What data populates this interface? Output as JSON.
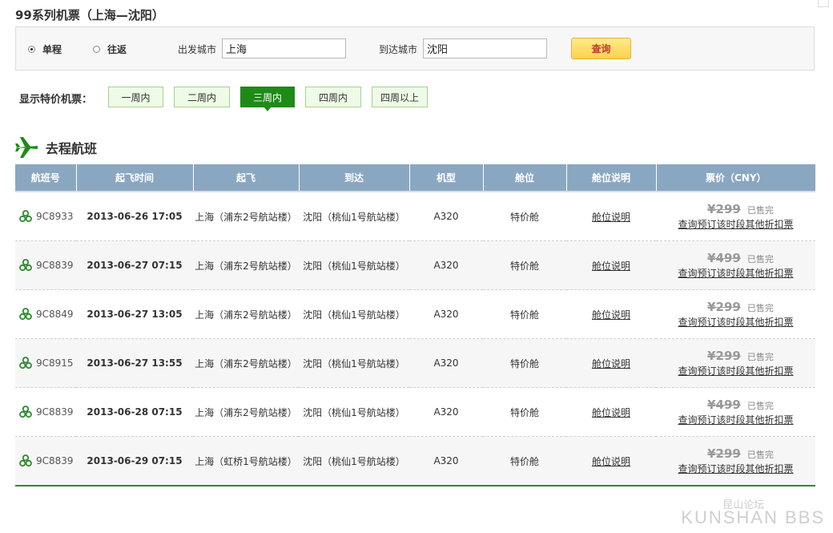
{
  "page_title": "99系列机票（上海—沈阳）",
  "search": {
    "trip_one_way": "单程",
    "trip_round": "往返",
    "from_label": "出发城市",
    "from_value": "上海",
    "to_label": "到达城市",
    "to_value": "沈阳",
    "query_button": "查询"
  },
  "filter": {
    "label": "显示特价机票：",
    "options": [
      "一周内",
      "二周内",
      "三周内",
      "四周内",
      "四周以上"
    ],
    "active": "三周内"
  },
  "section_title": "去程航班",
  "table": {
    "headers": [
      "航班号",
      "起飞时间",
      "起飞",
      "到达",
      "机型",
      "舱位",
      "舱位说明",
      "票价（CNY）"
    ],
    "rows": [
      {
        "flight": "9C8933",
        "time": "2013-06-26  17:05",
        "depart": "上海（浦东2号航站楼）",
        "arrive": "沈阳（桃仙1号航站楼）",
        "aircraft": "A320",
        "cabin": "特价舱",
        "cabin_info": "舱位说明",
        "price": "¥299",
        "status": "已售完",
        "more": "查询预订该时段其他折扣票"
      },
      {
        "flight": "9C8839",
        "time": "2013-06-27  07:15",
        "depart": "上海（浦东2号航站楼）",
        "arrive": "沈阳（桃仙1号航站楼）",
        "aircraft": "A320",
        "cabin": "特价舱",
        "cabin_info": "舱位说明",
        "price": "¥499",
        "status": "已售完",
        "more": "查询预订该时段其他折扣票"
      },
      {
        "flight": "9C8849",
        "time": "2013-06-27  13:05",
        "depart": "上海（浦东2号航站楼）",
        "arrive": "沈阳（桃仙1号航站楼）",
        "aircraft": "A320",
        "cabin": "特价舱",
        "cabin_info": "舱位说明",
        "price": "¥299",
        "status": "已售完",
        "more": "查询预订该时段其他折扣票"
      },
      {
        "flight": "9C8915",
        "time": "2013-06-27  13:55",
        "depart": "上海（浦东2号航站楼）",
        "arrive": "沈阳（桃仙1号航站楼）",
        "aircraft": "A320",
        "cabin": "特价舱",
        "cabin_info": "舱位说明",
        "price": "¥299",
        "status": "已售完",
        "more": "查询预订该时段其他折扣票"
      },
      {
        "flight": "9C8839",
        "time": "2013-06-28  07:15",
        "depart": "上海（浦东2号航站楼）",
        "arrive": "沈阳（桃仙1号航站楼）",
        "aircraft": "A320",
        "cabin": "特价舱",
        "cabin_info": "舱位说明",
        "price": "¥499",
        "status": "已售完",
        "more": "查询预订该时段其他折扣票"
      },
      {
        "flight": "9C8839",
        "time": "2013-06-29  07:15",
        "depart": "上海（虹桥1号航站楼）",
        "arrive": "沈阳（桃仙1号航站楼）",
        "aircraft": "A320",
        "cabin": "特价舱",
        "cabin_info": "舱位说明",
        "price": "¥299",
        "status": "已售完",
        "more": "查询预订该时段其他折扣票"
      }
    ]
  },
  "watermark": {
    "top": "昆山论坛",
    "bottom": "KUNSHAN BBS"
  },
  "colors": {
    "header_bg": "#8aa7c2",
    "active_filter": "#1e8b17",
    "query_button": "#ffd24a",
    "airline_icon": "#2e8b2e"
  },
  "icons": {
    "section": "airplane-icon",
    "airline": "airline-logo-icon"
  }
}
